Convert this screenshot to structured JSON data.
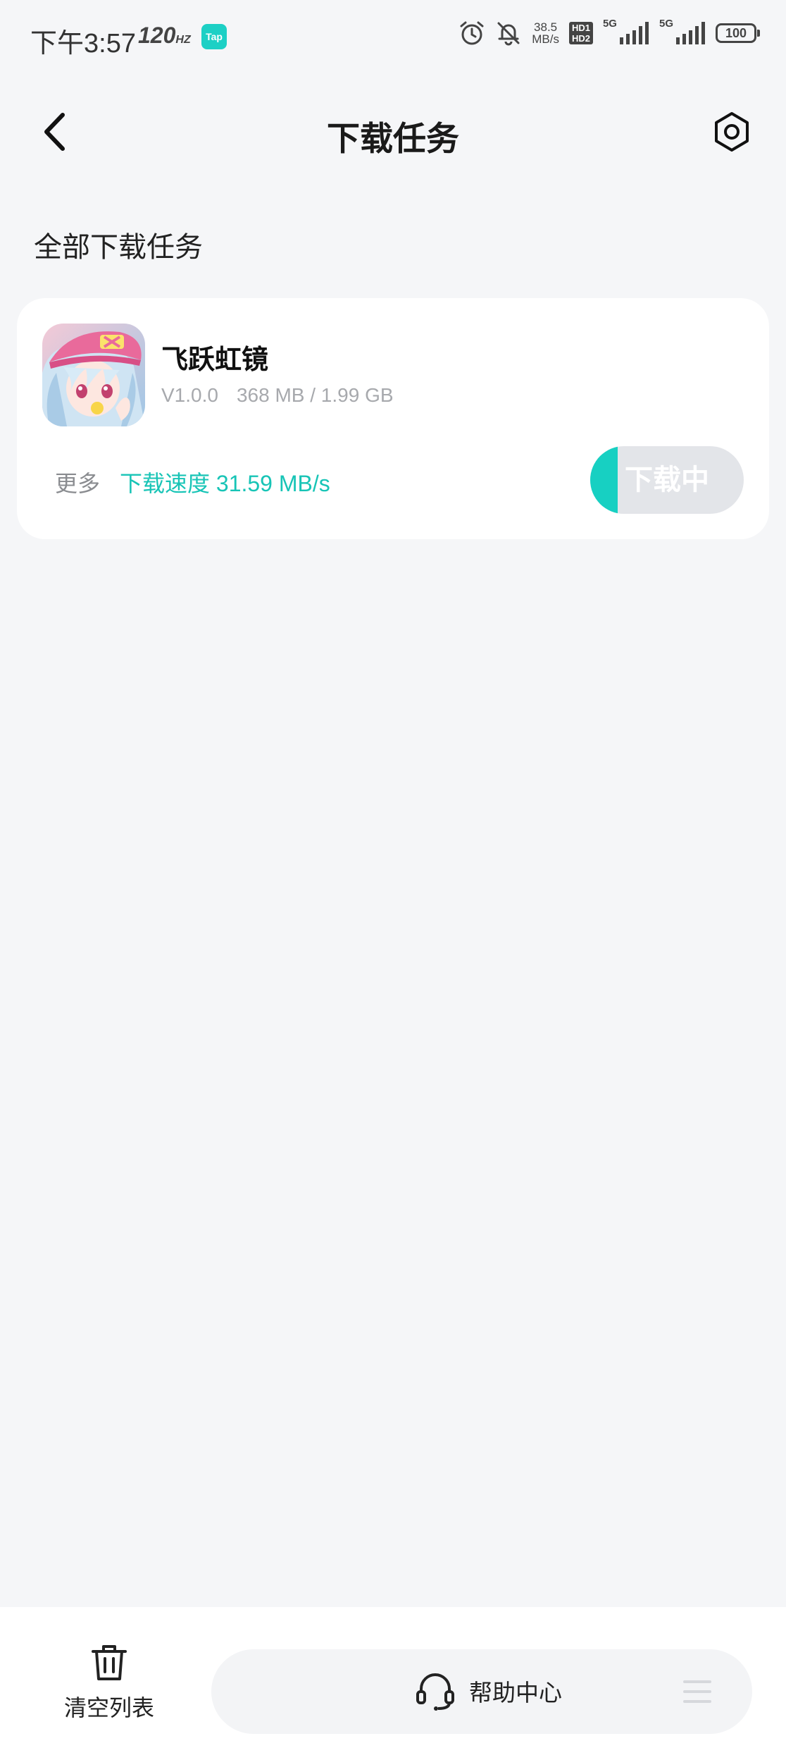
{
  "status_bar": {
    "time": "下午3:57",
    "refresh_rate": "120",
    "refresh_unit": "HZ",
    "tap_badge": "Tap",
    "net_speed_value": "38.5",
    "net_speed_unit": "MB/s",
    "hd1": "HD1",
    "hd2": "HD2",
    "signal1": "5G",
    "signal2": "5G",
    "battery": "100"
  },
  "header": {
    "title": "下载任务"
  },
  "section": {
    "title": "全部下载任务"
  },
  "task": {
    "app_name": "飞跃虹镜",
    "version": "V1.0.0",
    "size_progress": "368 MB / 1.99 GB",
    "more_label": "更多",
    "speed_label": "下载速度 31.59 MB/s",
    "button_label": "下载中",
    "progress_fraction": 0.18
  },
  "bottom_bar": {
    "clear_label": "清空列表",
    "help_label": "帮助中心"
  },
  "colors": {
    "accent": "#17c4b6",
    "background": "#f5f6f8",
    "card": "#ffffff"
  }
}
